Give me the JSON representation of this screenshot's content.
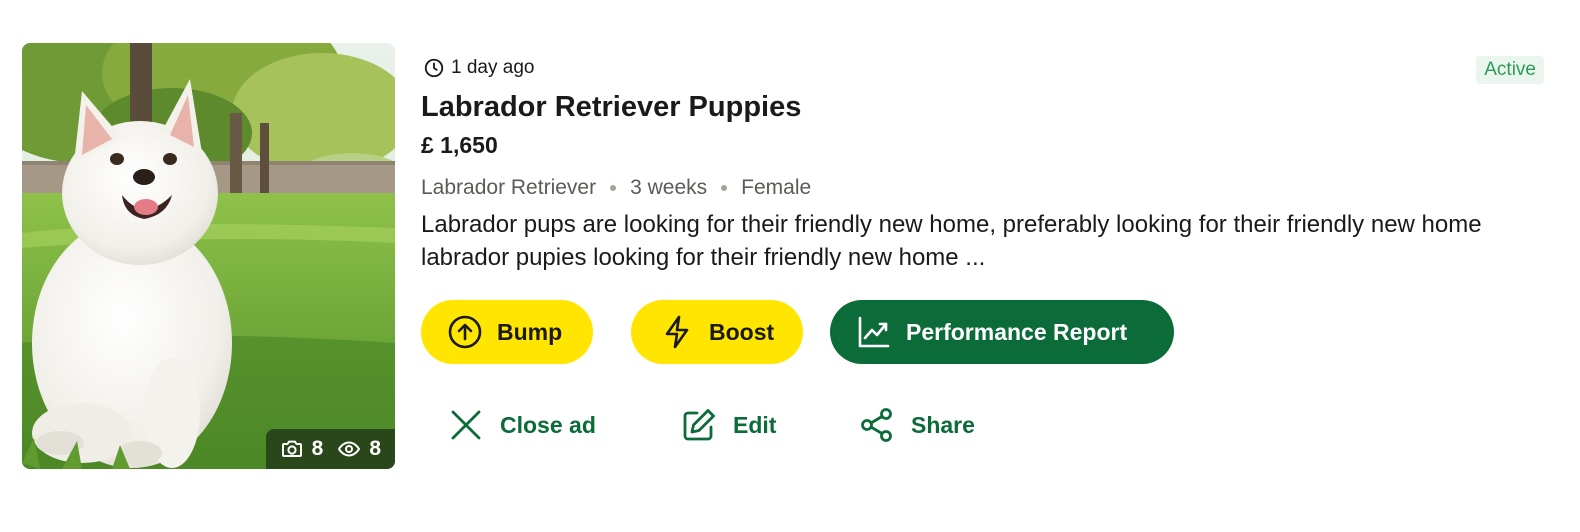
{
  "listing": {
    "posted": "1 day ago",
    "status": "Active",
    "title": "Labrador Retriever Puppies",
    "price": "£ 1,650",
    "meta": {
      "breed": "Labrador Retriever",
      "age": "3 weeks",
      "sex": "Female"
    },
    "description": "Labrador pups are looking for their friendly new home, preferably looking for their friendly new home labrador pupies looking for their friendly new home ...",
    "photo": {
      "subject": "white puppy sitting on grass",
      "photo_count": "8",
      "view_count": "8"
    }
  },
  "actions": {
    "bump": "Bump",
    "boost": "Boost",
    "report": "Performance Report",
    "close": "Close ad",
    "edit": "Edit",
    "share": "Share"
  },
  "icons": {
    "posted": "clock-icon",
    "photos": "camera-icon",
    "views": "eye-icon",
    "bump": "arrow-up-circle-icon",
    "boost": "lightning-icon",
    "report": "line-chart-icon",
    "close": "close-icon",
    "edit": "edit-icon",
    "share": "share-icon"
  },
  "colors": {
    "accent_yellow": "#ffe500",
    "brand_green": "#0b6b39",
    "status_green": "#2f9a5b",
    "status_bg": "#eaf5ee"
  }
}
